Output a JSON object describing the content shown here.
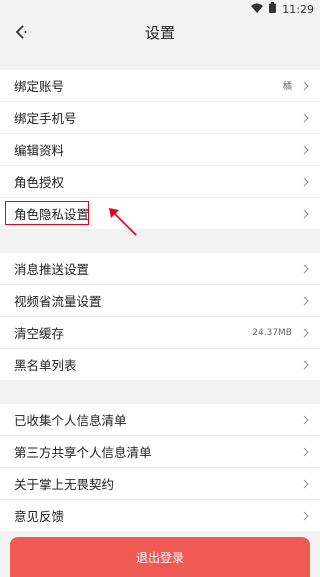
{
  "status_bar": {
    "time": "11:29"
  },
  "header": {
    "title": "设置"
  },
  "groups": [
    {
      "items": [
        {
          "label": "绑定账号",
          "value": "橘"
        },
        {
          "label": "绑定手机号"
        },
        {
          "label": "编辑资料"
        },
        {
          "label": "角色授权"
        },
        {
          "label": "角色隐私设置"
        }
      ]
    },
    {
      "items": [
        {
          "label": "消息推送设置"
        },
        {
          "label": "视频省流量设置"
        },
        {
          "label": "清空缓存",
          "value": "24.37MB"
        },
        {
          "label": "黑名单列表"
        }
      ]
    },
    {
      "items": [
        {
          "label": "已收集个人信息清单"
        },
        {
          "label": "第三方共享个人信息清单"
        },
        {
          "label": "关于掌上无畏契约"
        },
        {
          "label": "意见反馈"
        }
      ]
    }
  ],
  "logout_label": "退出登录",
  "colors": {
    "highlight": "#e3001b",
    "logout_bg": "#ef5a55"
  }
}
